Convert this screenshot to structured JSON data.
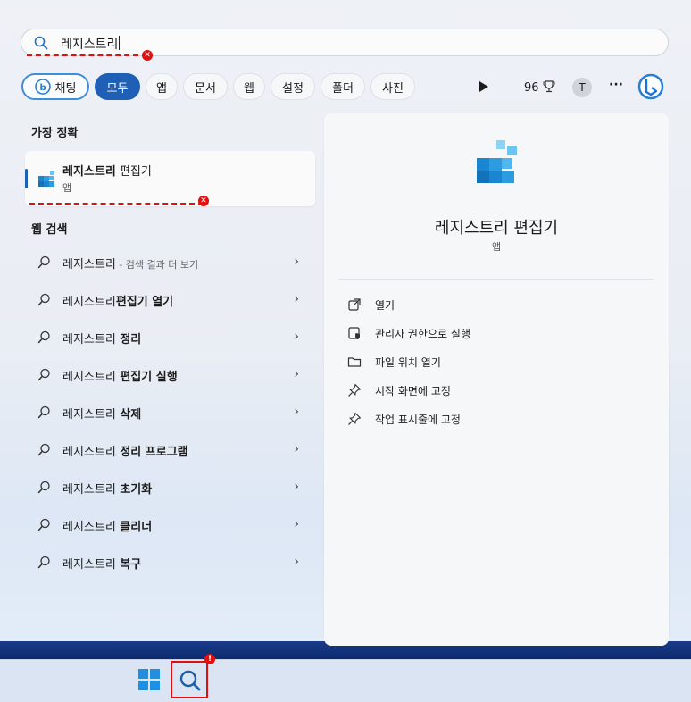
{
  "search": {
    "query": "레지스트리"
  },
  "tabs": {
    "chat": "채팅",
    "all": "모두",
    "apps": "앱",
    "documents": "문서",
    "web": "웹",
    "settings": "설정",
    "folders": "폴더",
    "photos": "사진",
    "points": "96",
    "avatar": "T",
    "more": "···"
  },
  "best_match": {
    "heading": "가장 정확",
    "title_bold": "레지스트리",
    "title_rest": " 편집기",
    "subtitle": "앱"
  },
  "web_search": {
    "heading": "웹 검색",
    "items": [
      {
        "prefix": "레지스트리",
        "rest": "",
        "hint": " - 검색 결과 더 보기"
      },
      {
        "prefix": "레지스트리",
        "rest": "편집기 열기",
        "hint": ""
      },
      {
        "prefix": "레지스트리",
        "rest": " 정리",
        "hint": ""
      },
      {
        "prefix": "레지스트리",
        "rest": " 편집기 실행",
        "hint": ""
      },
      {
        "prefix": "레지스트리",
        "rest": " 삭제",
        "hint": ""
      },
      {
        "prefix": "레지스트리",
        "rest": " 정리 프로그램",
        "hint": ""
      },
      {
        "prefix": "레지스트리",
        "rest": " 초기화",
        "hint": ""
      },
      {
        "prefix": "레지스트리",
        "rest": " 클리너",
        "hint": ""
      },
      {
        "prefix": "레지스트리",
        "rest": " 복구",
        "hint": ""
      }
    ]
  },
  "detail": {
    "title": "레지스트리 편집기",
    "subtitle": "앱",
    "actions": [
      {
        "label": "열기",
        "icon": "open-external-icon"
      },
      {
        "label": "관리자 권한으로 실행",
        "icon": "admin-shield-icon"
      },
      {
        "label": "파일 위치 열기",
        "icon": "folder-icon"
      },
      {
        "label": "시작 화면에 고정",
        "icon": "pin-icon"
      },
      {
        "label": "작업 표시줄에 고정",
        "icon": "pin-icon"
      }
    ]
  },
  "colors": {
    "accent": "#1f5fb5",
    "annotation": "#e01010"
  }
}
